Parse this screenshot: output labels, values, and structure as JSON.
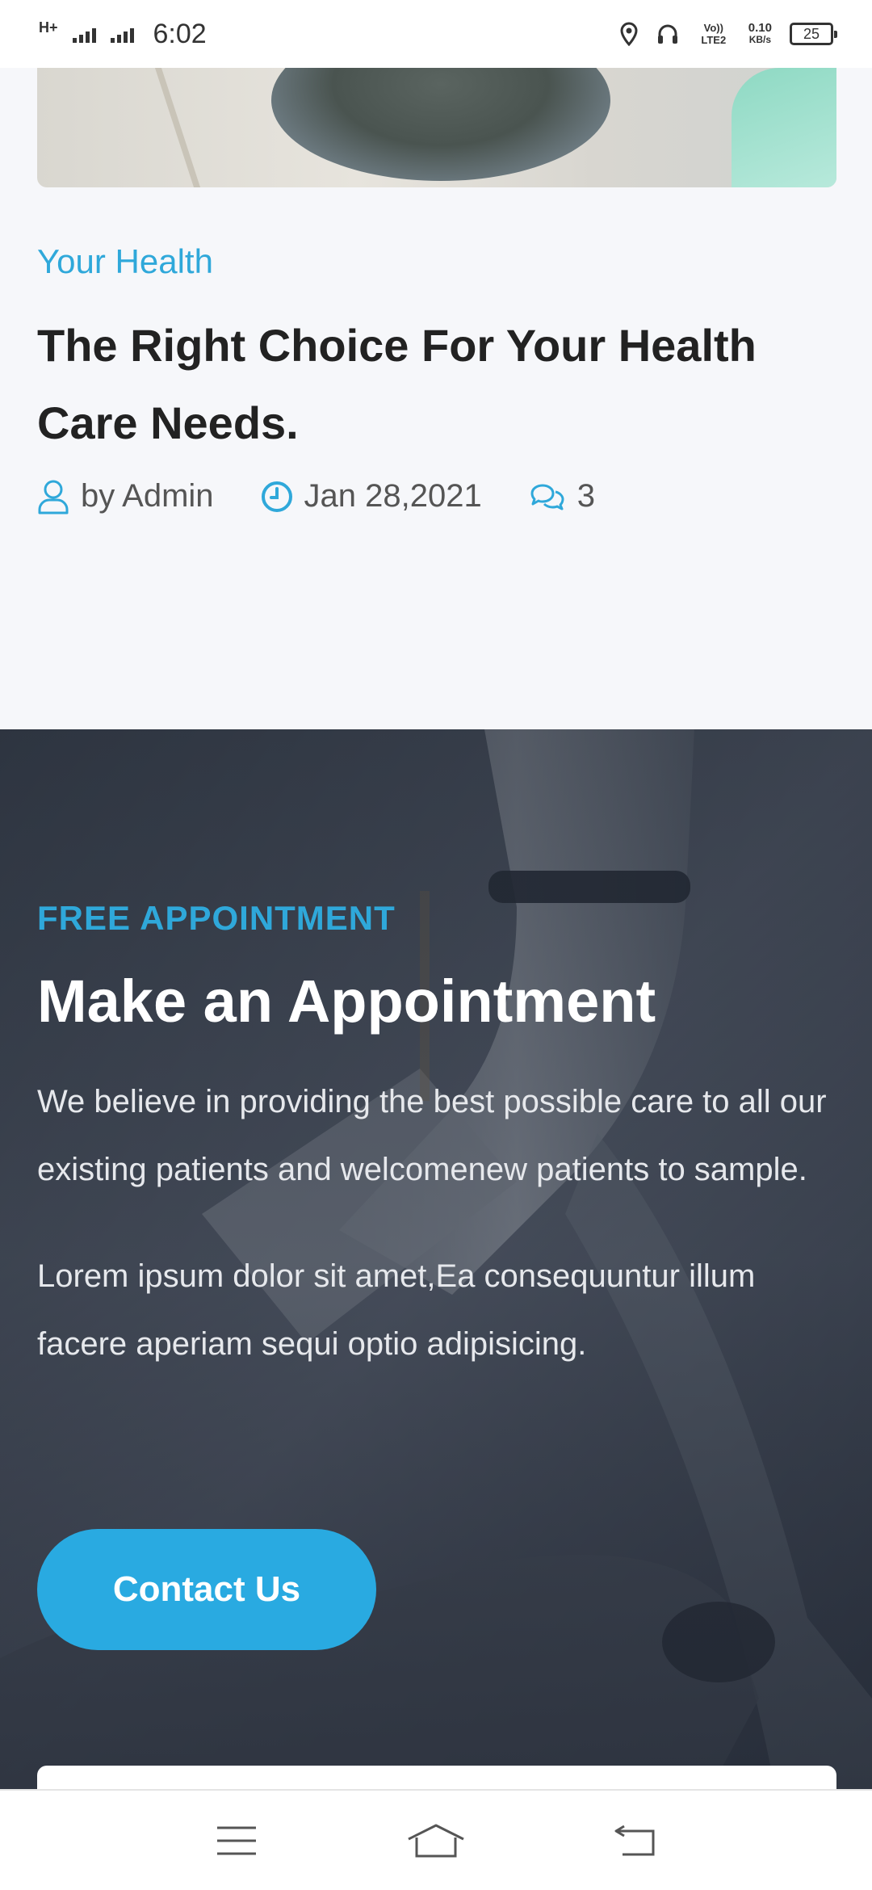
{
  "status_bar": {
    "network_type": "H+",
    "time": "6:02",
    "volte": "Vo)) LTE2",
    "speed_value": "0.10",
    "speed_unit": "KB/s",
    "battery": "25"
  },
  "post": {
    "category": "Your Health",
    "title": "The Right Choice For Your Health Care Needs.",
    "author": "by Admin",
    "date": "Jan 28,2021",
    "comments": "3"
  },
  "appointment": {
    "kicker": "FREE APPOINTMENT",
    "title": "Make an Appointment",
    "paragraph_1": "We believe in providing the best possible care to all our existing patients and welcomenew patients to sample.",
    "paragraph_2": "Lorem ipsum dolor sit amet,Ea consequuntur illum facere aperiam sequi optio adipisicing.",
    "button_label": "Contact Us"
  },
  "nav_bar": {
    "icons": [
      "menu-icon",
      "home-icon",
      "back-icon"
    ]
  },
  "colors": {
    "accent": "#29aae1",
    "title_text": "#222222",
    "section_dark": "#2b3340"
  }
}
